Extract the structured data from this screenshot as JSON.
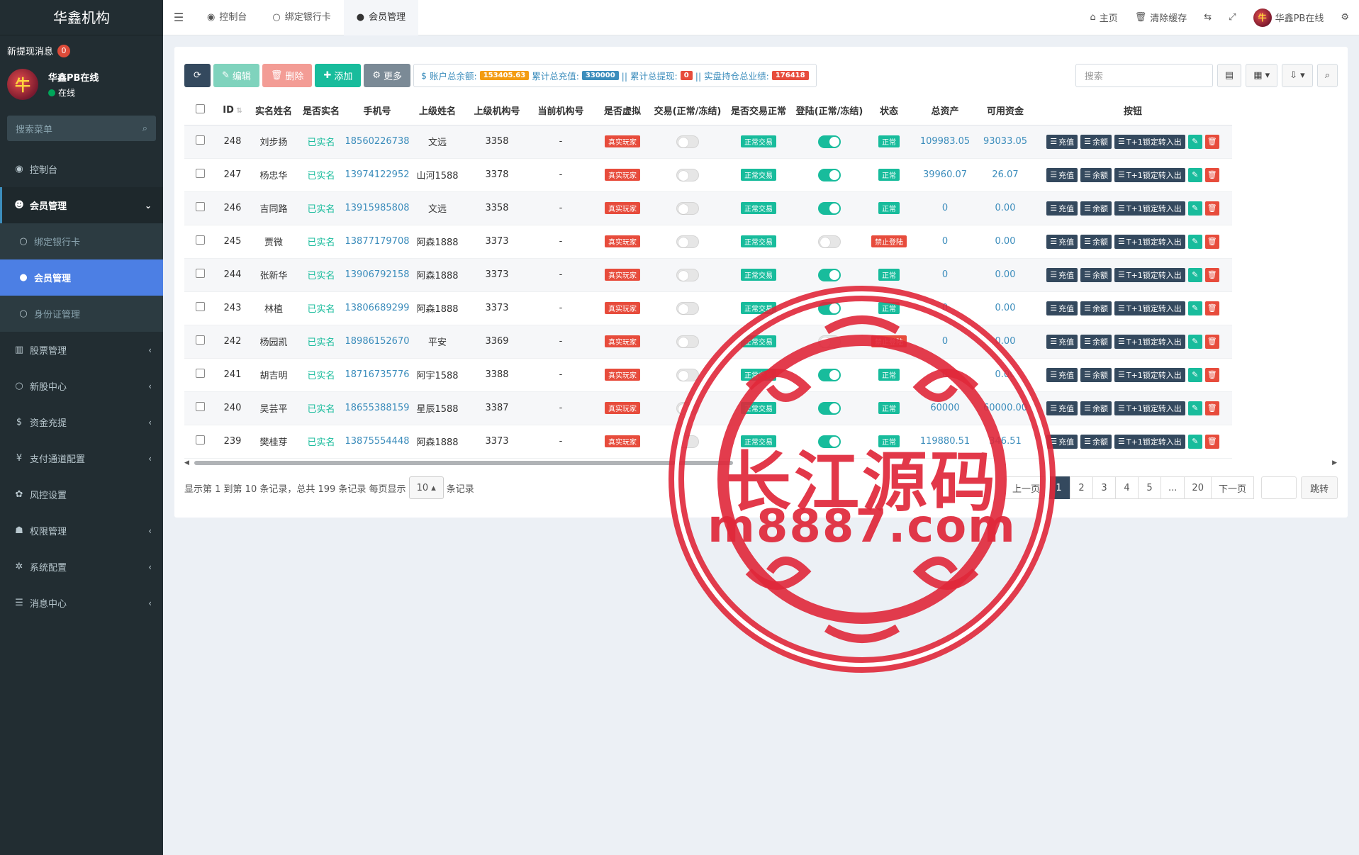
{
  "sidebar": {
    "logo": "华鑫机构",
    "notice_label": "新提现消息",
    "notice_count": "0",
    "user": {
      "avatar_char": "牛",
      "name": "华鑫PB在线",
      "status": "在线"
    },
    "search_placeholder": "搜索菜单",
    "menu": [
      {
        "label": "控制台",
        "icon": "dashboard-icon",
        "glyph": "◉"
      },
      {
        "label": "会员管理",
        "icon": "user-circle-icon",
        "glyph": "☻"
      },
      {
        "label": "绑定银行卡",
        "icon": "circle-icon",
        "glyph": "○"
      },
      {
        "label": "会员管理",
        "icon": "user-icon",
        "glyph": "●"
      },
      {
        "label": "身份证管理",
        "icon": "circle-icon",
        "glyph": "○"
      },
      {
        "label": "股票管理",
        "icon": "bank-icon",
        "glyph": "▥"
      },
      {
        "label": "新股中心",
        "icon": "circle-icon",
        "glyph": "○"
      },
      {
        "label": "资金充提",
        "icon": "dollar-icon",
        "glyph": "$"
      },
      {
        "label": "支付通道配置",
        "icon": "yen-icon",
        "glyph": "¥"
      },
      {
        "label": "风控设置",
        "icon": "gear-icon",
        "glyph": "✿"
      },
      {
        "label": "权限管理",
        "icon": "group-icon",
        "glyph": "☗"
      },
      {
        "label": "系统配置",
        "icon": "cog-icon",
        "glyph": "✲"
      },
      {
        "label": "消息中心",
        "icon": "list-icon",
        "glyph": "☰"
      }
    ]
  },
  "topbar": {
    "tabs": [
      {
        "label": "控制台",
        "glyph": "◉"
      },
      {
        "label": "绑定银行卡",
        "glyph": "○"
      },
      {
        "label": "会员管理",
        "glyph": "●"
      }
    ],
    "home": "主页",
    "clear_cache": "清除缓存",
    "username": "华鑫PB在线"
  },
  "toolbar": {
    "edit": "编辑",
    "delete": "删除",
    "add": "添加",
    "more": "更多",
    "stats": {
      "balance_label": "账户总余额:",
      "balance": "153405.63",
      "recharge_label": "累计总充值:",
      "recharge": "330000",
      "withdraw_label": "|| 累计总提现:",
      "withdraw": "0",
      "hold_label": "|| 实盘持仓总业绩:",
      "hold": "176418"
    },
    "search_placeholder": "搜索"
  },
  "table": {
    "headers": [
      "ID",
      "实名姓名",
      "是否实名",
      "手机号",
      "上级姓名",
      "上级机构号",
      "当前机构号",
      "是否虚拟",
      "交易(正常/冻结)",
      "是否交易正常",
      "登陆(正常/冻结)",
      "状态",
      "总资产",
      "可用资金",
      "按钮"
    ],
    "rows": [
      {
        "id": "248",
        "name": "刘步扬",
        "verified": "已实名",
        "phone": "18560226738",
        "parent": "文远",
        "parent_org": "3358",
        "org": "-",
        "virtual": "真实玩家",
        "trade": false,
        "trade_ok": "正常交易",
        "login": true,
        "status": "正常",
        "status_ok": true,
        "total": "109983.05",
        "avail": "93033.05"
      },
      {
        "id": "247",
        "name": "杨忠华",
        "verified": "已实名",
        "phone": "13974122952",
        "parent": "山河1588",
        "parent_org": "3378",
        "org": "-",
        "virtual": "真实玩家",
        "trade": false,
        "trade_ok": "正常交易",
        "login": true,
        "status": "正常",
        "status_ok": true,
        "total": "39960.07",
        "avail": "26.07"
      },
      {
        "id": "246",
        "name": "吉同路",
        "verified": "已实名",
        "phone": "13915985808",
        "parent": "文远",
        "parent_org": "3358",
        "org": "-",
        "virtual": "真实玩家",
        "trade": false,
        "trade_ok": "正常交易",
        "login": true,
        "status": "正常",
        "status_ok": true,
        "total": "0",
        "avail": "0.00"
      },
      {
        "id": "245",
        "name": "贾微",
        "verified": "已实名",
        "phone": "13877179708",
        "parent": "阿森1888",
        "parent_org": "3373",
        "org": "-",
        "virtual": "真实玩家",
        "trade": false,
        "trade_ok": "正常交易",
        "login": false,
        "status": "禁止登陆",
        "status_ok": false,
        "total": "0",
        "avail": "0.00"
      },
      {
        "id": "244",
        "name": "张新华",
        "verified": "已实名",
        "phone": "13906792158",
        "parent": "阿森1888",
        "parent_org": "3373",
        "org": "-",
        "virtual": "真实玩家",
        "trade": false,
        "trade_ok": "正常交易",
        "login": true,
        "status": "正常",
        "status_ok": true,
        "total": "0",
        "avail": "0.00"
      },
      {
        "id": "243",
        "name": "林植",
        "verified": "已实名",
        "phone": "13806689299",
        "parent": "阿森1888",
        "parent_org": "3373",
        "org": "-",
        "virtual": "真实玩家",
        "trade": false,
        "trade_ok": "正常交易",
        "login": true,
        "status": "正常",
        "status_ok": true,
        "total": "0",
        "avail": "0.00"
      },
      {
        "id": "242",
        "name": "杨园凯",
        "verified": "已实名",
        "phone": "18986152670",
        "parent": "平安",
        "parent_org": "3369",
        "org": "-",
        "virtual": "真实玩家",
        "trade": false,
        "trade_ok": "正常交易",
        "login": false,
        "status": "禁止登陆",
        "status_ok": false,
        "total": "0",
        "avail": "0.00"
      },
      {
        "id": "241",
        "name": "胡吉明",
        "verified": "已实名",
        "phone": "18716735776",
        "parent": "阿宇1588",
        "parent_org": "3388",
        "org": "-",
        "virtual": "真实玩家",
        "trade": false,
        "trade_ok": "正常交易",
        "login": true,
        "status": "正常",
        "status_ok": true,
        "total": "0",
        "avail": "0.00"
      },
      {
        "id": "240",
        "name": "吴芸平",
        "verified": "已实名",
        "phone": "18655388159",
        "parent": "星辰1588",
        "parent_org": "3387",
        "org": "-",
        "virtual": "真实玩家",
        "trade": false,
        "trade_ok": "正常交易",
        "login": true,
        "status": "正常",
        "status_ok": true,
        "total": "60000",
        "avail": "60000.00"
      },
      {
        "id": "239",
        "name": "樊桂芽",
        "verified": "已实名",
        "phone": "13875554448",
        "parent": "阿森1888",
        "parent_org": "3373",
        "org": "-",
        "virtual": "真实玩家",
        "trade": false,
        "trade_ok": "正常交易",
        "login": true,
        "status": "正常",
        "status_ok": true,
        "total": "119880.51",
        "avail": "346.51"
      }
    ],
    "action_labels": {
      "recharge": "充值",
      "balance": "余额",
      "lock": "T+1锁定转入出"
    }
  },
  "footer": {
    "info_prefix": "显示第 1 到第 10 条记录，总共 199 条记录 每页显示",
    "page_size": "10",
    "info_suffix": "条记录",
    "pages": [
      "上一页",
      "1",
      "2",
      "3",
      "4",
      "5",
      "...",
      "20",
      "下一页"
    ],
    "active_page": "1",
    "jump": "跳转"
  },
  "watermark": {
    "cn": "长江源码",
    "en": "m8887.com"
  },
  "colors": {
    "sidebar": "#222d32",
    "accent": "#4c7fe4",
    "success": "#18bc9c",
    "danger": "#e74c3c",
    "dark": "#34495e"
  }
}
